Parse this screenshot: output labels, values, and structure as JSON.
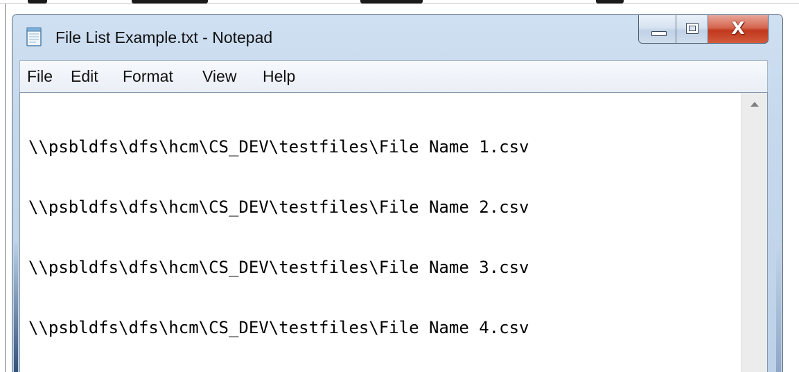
{
  "window": {
    "title": "File List Example.txt - Notepad",
    "icon": "notepad-icon",
    "controls": {
      "minimize_icon": "minimize-icon",
      "maximize_icon": "maximize-icon",
      "close_label": "X"
    }
  },
  "menu": {
    "items": [
      {
        "label": "File"
      },
      {
        "label": "Edit"
      },
      {
        "label": "Format"
      },
      {
        "label": "View"
      },
      {
        "label": "Help"
      }
    ]
  },
  "editor": {
    "lines": [
      "\\\\psbldfs\\dfs\\hcm\\CS_DEV\\testfiles\\File Name 1.csv",
      "\\\\psbldfs\\dfs\\hcm\\CS_DEV\\testfiles\\File Name 2.csv",
      "\\\\psbldfs\\dfs\\hcm\\CS_DEV\\testfiles\\File Name 3.csv",
      "\\\\psbldfs\\dfs\\hcm\\CS_DEV\\testfiles\\File Name 4.csv"
    ]
  },
  "colors": {
    "titlebar": "#c6d8ec",
    "close_button": "#c0381d",
    "editor_background": "#ffffff",
    "text": "#000000"
  }
}
